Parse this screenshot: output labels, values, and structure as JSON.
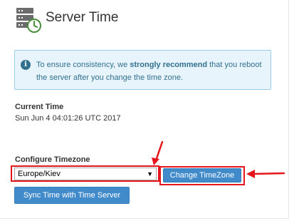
{
  "header": {
    "title": "Server Time",
    "icon": "server-clock-icon"
  },
  "notice": {
    "icon": "info-icon",
    "glyph": "i",
    "text_before": "To ensure consistency, we ",
    "text_strong": "strongly recommend",
    "text_after": " that you reboot the server after you change the time zone."
  },
  "current_time": {
    "label": "Current Time",
    "value": "Sun Jun 4 04:01:26 UTC 2017"
  },
  "timezone": {
    "label": "Configure Timezone",
    "selected": "Europe/Kiev",
    "caret": "▼",
    "change_button": "Change TimeZone"
  },
  "sync": {
    "button": "Sync Time with Time Server"
  },
  "colors": {
    "primary_button": "#428bca",
    "info_bg": "#e8f4fb",
    "info_text": "#31708f",
    "highlight": "#e4161c"
  }
}
